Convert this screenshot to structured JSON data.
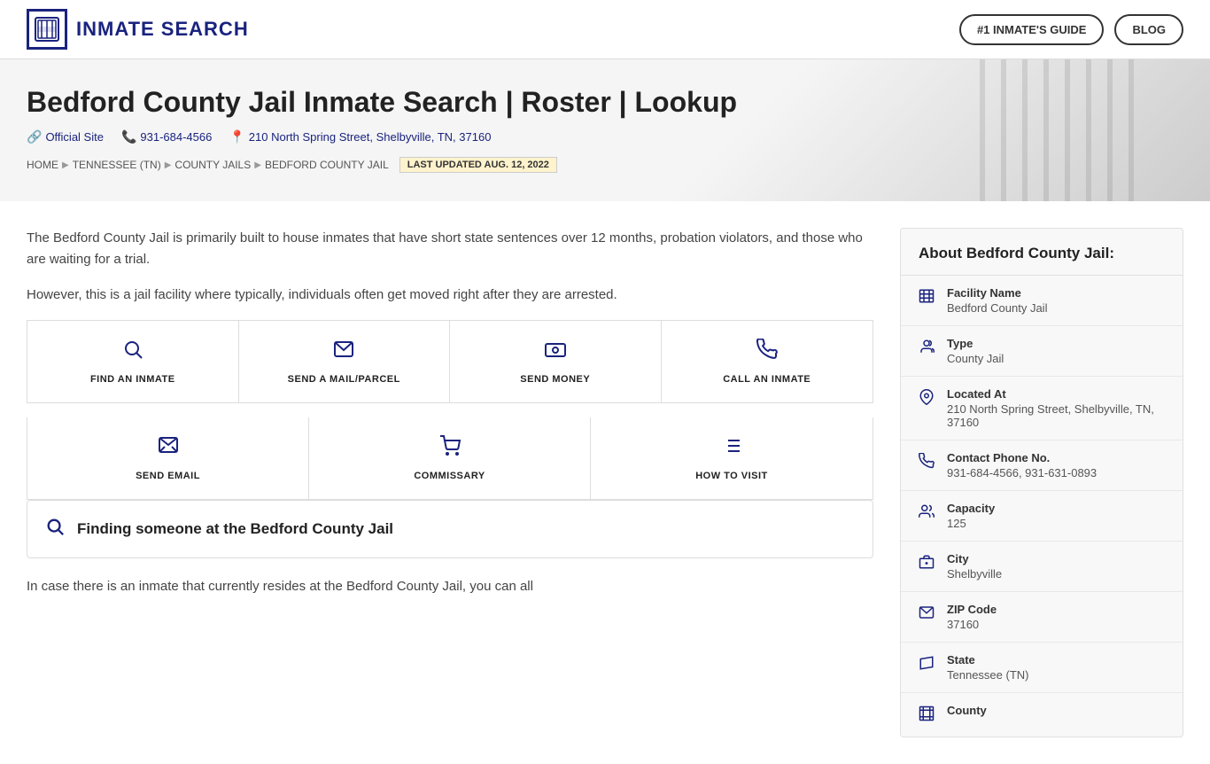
{
  "header": {
    "logo_text": "INMATE SEARCH",
    "nav_btn1": "#1 INMATE'S GUIDE",
    "nav_btn2": "BLOG"
  },
  "hero": {
    "title": "Bedford County Jail Inmate Search | Roster | Lookup",
    "official_site": "Official Site",
    "phone": "931-684-4566",
    "address": "210 North Spring Street, Shelbyville, TN, 37160",
    "breadcrumb": {
      "home": "HOME",
      "state": "TENNESSEE (TN)",
      "county_jails": "COUNTY JAILS",
      "current": "BEDFORD COUNTY JAIL",
      "badge": "LAST UPDATED AUG. 12, 2022"
    }
  },
  "main": {
    "para1": "The Bedford County Jail is primarily built to house inmates that have short state sentences over 12 months, probation violators, and those who are waiting for a trial.",
    "para2": "However, this is a jail facility where typically, individuals often get moved right after they are arrested.",
    "actions": [
      {
        "id": "find-inmate",
        "icon": "🔍",
        "label": "FIND AN INMATE"
      },
      {
        "id": "send-mail",
        "icon": "✉️",
        "label": "SEND A MAIL/PARCEL"
      },
      {
        "id": "send-money",
        "icon": "💸",
        "label": "SEND MONEY"
      },
      {
        "id": "call-inmate",
        "icon": "📞",
        "label": "CALL AN INMATE"
      }
    ],
    "actions2": [
      {
        "id": "send-email",
        "icon": "💬",
        "label": "SEND EMAIL"
      },
      {
        "id": "commissary",
        "icon": "🛒",
        "label": "COMMISSARY"
      },
      {
        "id": "how-to-visit",
        "icon": "📋",
        "label": "HOW TO VISIT"
      }
    ],
    "search_box_text": "Finding someone at the Bedford County Jail",
    "content_text": "In case there is an inmate that currently resides at the Bedford County Jail, you can all"
  },
  "sidebar": {
    "title": "About Bedford County Jail:",
    "items": [
      {
        "id": "facility-name",
        "icon": "🏢",
        "label": "Facility Name",
        "value": "Bedford County Jail"
      },
      {
        "id": "type",
        "icon": "👤",
        "label": "Type",
        "value": "County Jail"
      },
      {
        "id": "located-at",
        "icon": "📍",
        "label": "Located At",
        "value": "210 North Spring Street, Shelbyville, TN, 37160"
      },
      {
        "id": "contact-phone",
        "icon": "📞",
        "label": "Contact Phone No.",
        "value": "931-684-4566, 931-631-0893"
      },
      {
        "id": "capacity",
        "icon": "👥",
        "label": "Capacity",
        "value": "125"
      },
      {
        "id": "city",
        "icon": "🏙️",
        "label": "City",
        "value": "Shelbyville"
      },
      {
        "id": "zip-code",
        "icon": "✉️",
        "label": "ZIP Code",
        "value": "37160"
      },
      {
        "id": "state",
        "icon": "🗺️",
        "label": "State",
        "value": "Tennessee (TN)"
      },
      {
        "id": "county",
        "icon": "🏛️",
        "label": "County",
        "value": ""
      }
    ]
  }
}
